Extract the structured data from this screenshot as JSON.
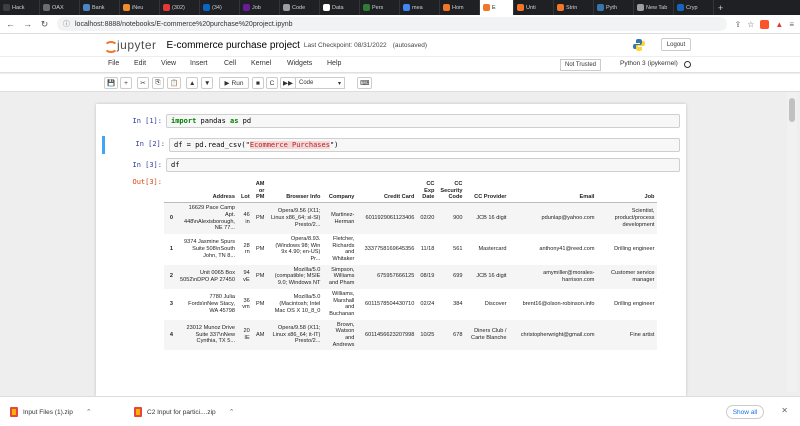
{
  "browser": {
    "tabs": [
      {
        "label": "Hack",
        "color": "#3c4043"
      },
      {
        "label": "OAX",
        "color": "#6c6c6c"
      },
      {
        "label": "Bank",
        "color": "#4a86c5"
      },
      {
        "label": "iNeu",
        "color": "#f28c28"
      },
      {
        "label": "(302)",
        "color": "#e53935"
      },
      {
        "label": "(34)",
        "color": "#0a66c2"
      },
      {
        "label": "Job",
        "color": "#6a1b9a"
      },
      {
        "label": "Code",
        "color": "#9e9e9e"
      },
      {
        "label": "Data",
        "color": "#ffffff"
      },
      {
        "label": "Pers",
        "color": "#2e7d32"
      },
      {
        "label": "mea",
        "color": "#4285f4"
      },
      {
        "label": "Hom",
        "color": "#f37626"
      },
      {
        "label": "E",
        "color": "#f37626"
      },
      {
        "label": "Unti",
        "color": "#f37626"
      },
      {
        "label": "Strin",
        "color": "#f37626"
      },
      {
        "label": "Pyth",
        "color": "#3776ab"
      },
      {
        "label": "New Tab",
        "color": "#9e9e9e"
      },
      {
        "label": "Cryp",
        "color": "#1565c0"
      }
    ],
    "active_tab_index": 12,
    "url": "localhost:8888/notebooks/E-commerce%20purchase%20project.ipynb"
  },
  "jupyter": {
    "logo_text": "jupyter",
    "notebook_title": "E-commerce purchase project",
    "checkpoint": "Last Checkpoint: 08/31/2022",
    "autosaved": "(autosaved)",
    "logout_label": "Logout",
    "menu": [
      "File",
      "Edit",
      "View",
      "Insert",
      "Cell",
      "Kernel",
      "Widgets",
      "Help"
    ],
    "trust_status": "Not Trusted",
    "kernel_name": "Python 3 (ipykernel)",
    "toolbar": {
      "save": "💾",
      "add": "+",
      "cut": "✂",
      "copy": "⎘",
      "paste": "📋",
      "up": "▲",
      "down": "▼",
      "run_icon": "▶",
      "run_label": "Run",
      "stop": "■",
      "restart": "C",
      "fast": "▶▶",
      "cell_type": "Code",
      "keyboard": "⌨"
    }
  },
  "cells": [
    {
      "prompt": "In [1]:",
      "keyword": "import",
      "code_a": " pandas ",
      "keyword2": "as",
      "code_b": " pd"
    },
    {
      "prompt": "In [2]:",
      "code_pre": "df = pd.read_csv(\"",
      "string": "Ecommerce Purchases",
      "code_post": "\")"
    },
    {
      "prompt": "In [3]:",
      "code": "df"
    }
  ],
  "output_prompt": "Out[3]:",
  "dataframe": {
    "columns": [
      "",
      "Address",
      "Lot",
      "AM or PM",
      "Browser Info",
      "Company",
      "Credit Card",
      "CC Exp Date",
      "CC Security Code",
      "CC Provider",
      "Email",
      "Job"
    ],
    "rows": [
      [
        "0",
        "16629 Pace Camp Apt. 448\\nAlexisborough, NE 77...",
        "46 in",
        "PM",
        "Opera/9.56 (X11; Linux x86_64; sl-SI) Presto/2...",
        "Martinez-Herman",
        "6011929061123406",
        "02/20",
        "900",
        "JCB 16 digit",
        "pdunlap@yahoo.com",
        "Scientist, product/process development"
      ],
      [
        "1",
        "9374 Jasmine Spurs Suite 508\\nSouth John, TN 8...",
        "28 rn",
        "PM",
        "Opera/8.93.(Windows 98; Win 9x 4.90; en-US) Pr...",
        "Fletcher, Richards and Whitaker",
        "3337758169645356",
        "11/18",
        "561",
        "Mastercard",
        "anthony41@reed.com",
        "Drilling engineer"
      ],
      [
        "2",
        "Unit 0065 Box 5052\\nDPO AP 27450",
        "94 vE",
        "PM",
        "Mozilla/5.0 (compatible; MSIE 9.0; Windows NT",
        "Simpson, Williams and Pham",
        "675957666125",
        "08/19",
        "699",
        "JCB 16 digit",
        "amymiller@morales-harrison.com",
        "Customer service manager"
      ],
      [
        "3",
        "7780 Julia Fords\\nNew Stacy, WA 45798",
        "36 vm",
        "PM",
        "Mozilla/5.0 (Macintosh; Intel Mac OS X 10_8_0",
        "Williams, Marshall and Buchanan",
        "6011578504430710",
        "02/24",
        "384",
        "Discover",
        "brent16@olson-robinson.info",
        "Drilling engineer"
      ],
      [
        "4",
        "23012 Munoz Drive Suite 337\\nNew Cynthia, TX 5...",
        "20 IE",
        "AM",
        "Opera/9.58 (X11; Linux x86_64; it-IT) Presto/2...",
        "Brown, Watson and Andrews",
        "6011456623207998",
        "10/25",
        "678",
        "Diners Club / Carte Blanche",
        "christopherwright@gmail.com",
        "Fine artist"
      ]
    ]
  },
  "downloads": {
    "items": [
      "Input Files (1).zip",
      "C2 Input for partici....zip"
    ],
    "show_all": "Show all"
  }
}
